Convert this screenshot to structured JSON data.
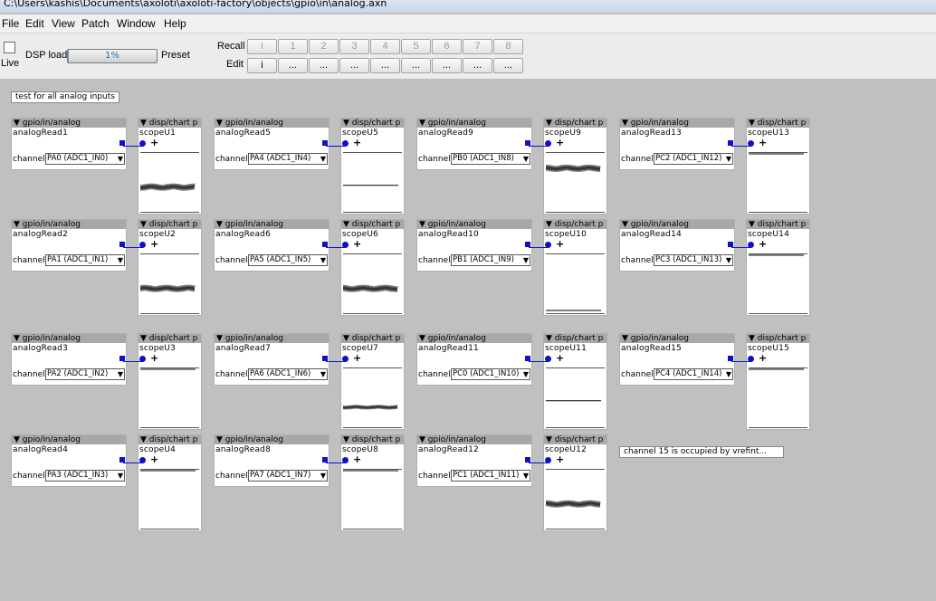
{
  "window": {
    "title": "C:\\Users\\kashis\\Documents\\axoloti\\axoloti-factory\\objects\\gpio\\in\\analog.axn"
  },
  "menu": {
    "items": [
      "File",
      "Edit",
      "View",
      "Patch",
      "Window",
      "Help"
    ]
  },
  "toolbar": {
    "live_label": "Live",
    "dsp_label": "DSP load",
    "dsp_value": "1%",
    "dsp_fraction": 0.01,
    "preset_label": "Preset",
    "recall_label": "Recall",
    "edit_label": "Edit",
    "recall_buttons": [
      "i",
      "1",
      "2",
      "3",
      "4",
      "5",
      "6",
      "7",
      "8"
    ],
    "edit_buttons": [
      "i",
      "...",
      "...",
      "...",
      "...",
      "...",
      "...",
      "...",
      "..."
    ]
  },
  "notes": {
    "top": "test for all analog inputs",
    "channel15": "channel 15 is occupied by vrefint..."
  },
  "colors": {
    "pin": "#1010c8",
    "header": "#a8a8a8",
    "canvas": "#c0c0c0"
  },
  "analog_objects": [
    {
      "type": "▼ gpio/in/analog",
      "name": "analogRead1",
      "channel_label": "channel",
      "channel": "PA0 (ADC1_IN0)"
    },
    {
      "type": "▼ gpio/in/analog",
      "name": "analogRead2",
      "channel_label": "channel",
      "channel": "PA1 (ADC1_IN1)"
    },
    {
      "type": "▼ gpio/in/analog",
      "name": "analogRead3",
      "channel_label": "channel",
      "channel": "PA2 (ADC1_IN2)"
    },
    {
      "type": "▼ gpio/in/analog",
      "name": "analogRead4",
      "channel_label": "channel",
      "channel": "PA3 (ADC1_IN3)"
    },
    {
      "type": "▼ gpio/in/analog",
      "name": "analogRead5",
      "channel_label": "channel",
      "channel": "PA4 (ADC1_IN4)"
    },
    {
      "type": "▼ gpio/in/analog",
      "name": "analogRead6",
      "channel_label": "channel",
      "channel": "PA5 (ADC1_IN5)"
    },
    {
      "type": "▼ gpio/in/analog",
      "name": "analogRead7",
      "channel_label": "channel",
      "channel": "PA6 (ADC1_IN6)"
    },
    {
      "type": "▼ gpio/in/analog",
      "name": "analogRead8",
      "channel_label": "channel",
      "channel": "PA7 (ADC1_IN7)"
    },
    {
      "type": "▼ gpio/in/analog",
      "name": "analogRead9",
      "channel_label": "channel",
      "channel": "PB0 (ADC1_IN8)"
    },
    {
      "type": "▼ gpio/in/analog",
      "name": "analogRead10",
      "channel_label": "channel",
      "channel": "PB1 (ADC1_IN9)"
    },
    {
      "type": "▼ gpio/in/analog",
      "name": "analogRead11",
      "channel_label": "channel",
      "channel": "PC0 (ADC1_IN10)"
    },
    {
      "type": "▼ gpio/in/analog",
      "name": "analogRead12",
      "channel_label": "channel",
      "channel": "PC1 (ADC1_IN11)"
    },
    {
      "type": "▼ gpio/in/analog",
      "name": "analogRead13",
      "channel_label": "channel",
      "channel": "PC2 (ADC1_IN12)"
    },
    {
      "type": "▼ gpio/in/analog",
      "name": "analogRead14",
      "channel_label": "channel",
      "channel": "PC3 (ADC1_IN13)"
    },
    {
      "type": "▼ gpio/in/analog",
      "name": "analogRead15",
      "channel_label": "channel",
      "channel": "PC4 (ADC1_IN14)"
    }
  ],
  "scope_objects": [
    {
      "type": "▼ disp/chart p",
      "name": "scopeU1",
      "signal": "noise"
    },
    {
      "type": "▼ disp/chart p",
      "name": "scopeU2",
      "signal": "noise"
    },
    {
      "type": "▼ disp/chart p",
      "name": "scopeU3",
      "signal": "top"
    },
    {
      "type": "▼ disp/chart p",
      "name": "scopeU4",
      "signal": "top"
    },
    {
      "type": "▼ disp/chart p",
      "name": "scopeU5",
      "signal": "mid"
    },
    {
      "type": "▼ disp/chart p",
      "name": "scopeU6",
      "signal": "noise"
    },
    {
      "type": "▼ disp/chart p",
      "name": "scopeU7",
      "signal": "noise-low"
    },
    {
      "type": "▼ disp/chart p",
      "name": "scopeU8",
      "signal": "top"
    },
    {
      "type": "▼ disp/chart p",
      "name": "scopeU9",
      "signal": "noise-high"
    },
    {
      "type": "▼ disp/chart p",
      "name": "scopeU10",
      "signal": "bottom"
    },
    {
      "type": "▼ disp/chart p",
      "name": "scopeU11",
      "signal": "mid"
    },
    {
      "type": "▼ disp/chart p",
      "name": "scopeU12",
      "signal": "noise"
    },
    {
      "type": "▼ disp/chart p",
      "name": "scopeU13",
      "signal": "top"
    },
    {
      "type": "▼ disp/chart p",
      "name": "scopeU14",
      "signal": "top"
    },
    {
      "type": "▼ disp/chart p",
      "name": "scopeU15",
      "signal": "top"
    }
  ]
}
